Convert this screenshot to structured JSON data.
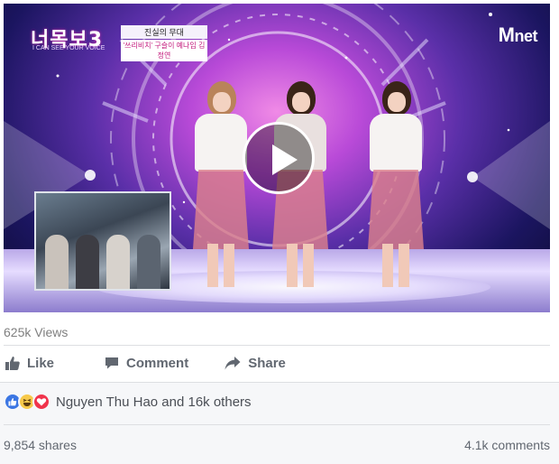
{
  "video": {
    "show_logo": "너목보3",
    "show_logo_sub": "I CAN SEE YOUR VOICE",
    "caption_top": "진실의 무대",
    "caption_bottom": "'쓰리비치' 구슬이 예나임 김정연",
    "channel_logo_m": "M",
    "channel_logo_rest": "net",
    "play_icon": "play-icon"
  },
  "stats": {
    "views": "625k Views"
  },
  "actions": {
    "like_label": "Like",
    "comment_label": "Comment",
    "share_label": "Share",
    "like_icon": "thumbs-up-icon",
    "comment_icon": "speech-bubble-icon",
    "share_icon": "share-arrow-icon"
  },
  "feedback": {
    "reactions": [
      "like",
      "haha",
      "love"
    ],
    "reaction_summary": "Nguyen Thu Hao and 16k others",
    "shares": "9,854 shares",
    "comments": "4.1k comments"
  },
  "colors": {
    "like_blue": "#3b76e3",
    "love_red": "#f0344c",
    "haha_yellow": "#f7c94a",
    "text_gray": "#616770"
  }
}
